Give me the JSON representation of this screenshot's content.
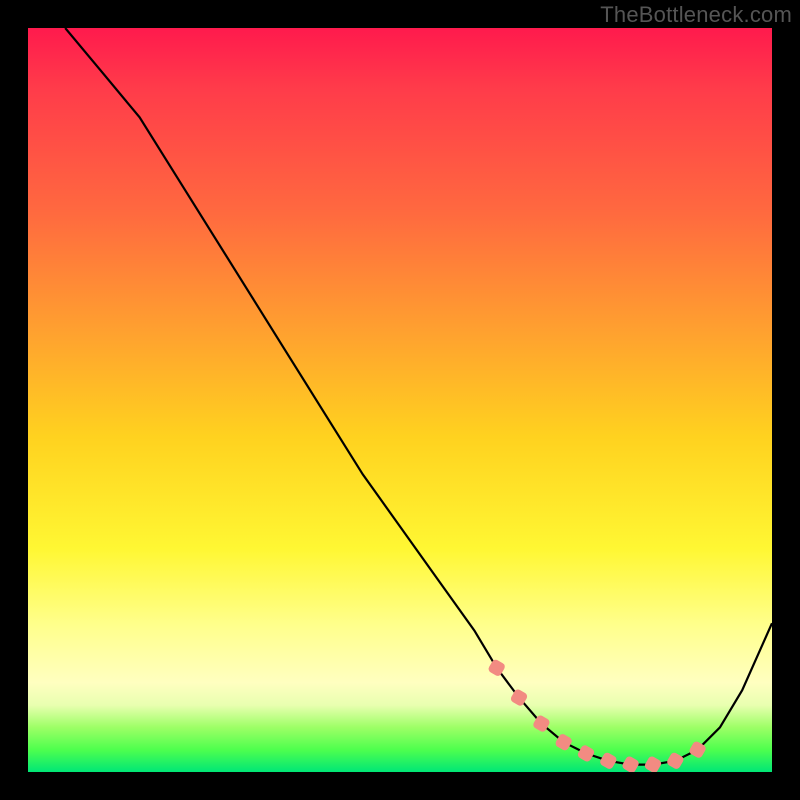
{
  "watermark": "TheBottleneck.com",
  "colors": {
    "background": "#000000",
    "curve_stroke": "#000000",
    "marker_fill": "#f28b82",
    "gradient_top": "#ff1a4d",
    "gradient_bottom": "#00e676"
  },
  "chart_data": {
    "type": "line",
    "title": "",
    "xlabel": "",
    "ylabel": "",
    "xlim": [
      0,
      100
    ],
    "ylim": [
      0,
      100
    ],
    "grid": false,
    "legend": false,
    "series": [
      {
        "name": "bottleneck-curve",
        "x": [
          5,
          10,
          15,
          20,
          25,
          30,
          35,
          40,
          45,
          50,
          55,
          60,
          63,
          66,
          69,
          72,
          75,
          78,
          81,
          84,
          87,
          90,
          93,
          96,
          100
        ],
        "y": [
          100,
          94,
          88,
          80,
          72,
          64,
          56,
          48,
          40,
          33,
          26,
          19,
          14,
          10,
          6.5,
          4,
          2.5,
          1.5,
          1,
          1,
          1.5,
          3,
          6,
          11,
          20
        ]
      }
    ],
    "markers": {
      "name": "highlight-points",
      "x": [
        63,
        66,
        69,
        72,
        75,
        78,
        81,
        84,
        87,
        90
      ],
      "y": [
        14,
        10,
        6.5,
        4,
        2.5,
        1.5,
        1,
        1,
        1.5,
        3
      ]
    }
  }
}
